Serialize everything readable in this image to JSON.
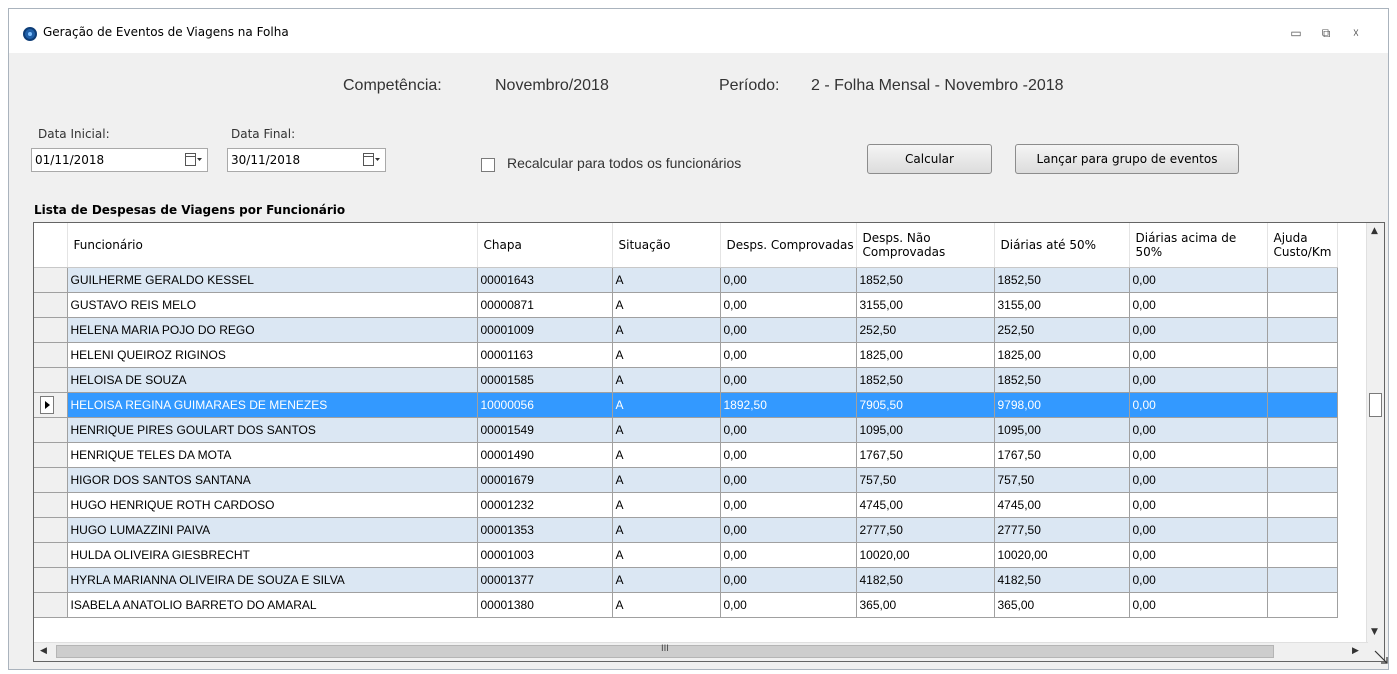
{
  "window": {
    "title": "Geração de Eventos de Viagens na Folha",
    "buttons": {
      "minimize": "▭",
      "restore": "⧉",
      "close": "☓"
    }
  },
  "header": {
    "competencia_label": "Competência:",
    "competencia_value": "Novembro/2018",
    "periodo_label": "Período:",
    "periodo_value": "2 - Folha Mensal - Novembro -2018"
  },
  "filters": {
    "data_inicial_label": "Data Inicial:",
    "data_inicial_value": "01/11/2018",
    "data_final_label": "Data Final:",
    "data_final_value": "30/11/2018",
    "recalcular_label": "Recalcular para todos os funcionários",
    "recalcular_checked": false,
    "calcular_button": "Calcular",
    "lancar_button": "Lançar para grupo de eventos"
  },
  "list": {
    "title": "Lista de Despesas de Viagens por Funcionário",
    "columns": [
      "Funcionário",
      "Chapa",
      "Situação",
      "Desps. Comprovadas",
      "Desps. Não Comprovadas",
      "Diárias até 50%",
      "Diárias acima de 50%",
      "Ajuda Custo/Km"
    ],
    "selected_row": 5,
    "rows": [
      [
        "GUILHERME GERALDO KESSEL",
        "00001643",
        "A",
        "0,00",
        "1852,50",
        "1852,50",
        "0,00",
        ""
      ],
      [
        "GUSTAVO REIS MELO",
        "00000871",
        "A",
        "0,00",
        "3155,00",
        "3155,00",
        "0,00",
        ""
      ],
      [
        "HELENA MARIA POJO DO REGO",
        "00001009",
        "A",
        "0,00",
        "252,50",
        "252,50",
        "0,00",
        ""
      ],
      [
        "HELENI QUEIROZ RIGINOS",
        "00001163",
        "A",
        "0,00",
        "1825,00",
        "1825,00",
        "0,00",
        ""
      ],
      [
        "HELOISA DE SOUZA",
        "00001585",
        "A",
        "0,00",
        "1852,50",
        "1852,50",
        "0,00",
        ""
      ],
      [
        "HELOISA REGINA GUIMARAES DE MENEZES",
        "10000056",
        "A",
        "1892,50",
        "7905,50",
        "9798,00",
        "0,00",
        ""
      ],
      [
        "HENRIQUE PIRES GOULART DOS SANTOS",
        "00001549",
        "A",
        "0,00",
        "1095,00",
        "1095,00",
        "0,00",
        ""
      ],
      [
        "HENRIQUE TELES DA MOTA",
        "00001490",
        "A",
        "0,00",
        "1767,50",
        "1767,50",
        "0,00",
        ""
      ],
      [
        "HIGOR DOS SANTOS SANTANA",
        "00001679",
        "A",
        "0,00",
        "757,50",
        "757,50",
        "0,00",
        ""
      ],
      [
        "HUGO HENRIQUE ROTH CARDOSO",
        "00001232",
        "A",
        "0,00",
        "4745,00",
        "4745,00",
        "0,00",
        ""
      ],
      [
        "HUGO LUMAZZINI PAIVA",
        "00001353",
        "A",
        "0,00",
        "2777,50",
        "2777,50",
        "0,00",
        ""
      ],
      [
        "HULDA OLIVEIRA GIESBRECHT",
        "00001003",
        "A",
        "0,00",
        "10020,00",
        "10020,00",
        "0,00",
        ""
      ],
      [
        "HYRLA MARIANNA OLIVEIRA DE SOUZA E SILVA",
        "00001377",
        "A",
        "0,00",
        "4182,50",
        "4182,50",
        "0,00",
        ""
      ],
      [
        "ISABELA ANATOLIO BARRETO DO AMARAL",
        "00001380",
        "A",
        "0,00",
        "365,00",
        "365,00",
        "0,00",
        ""
      ]
    ]
  },
  "scroll": {
    "hthumb_label": "III"
  }
}
